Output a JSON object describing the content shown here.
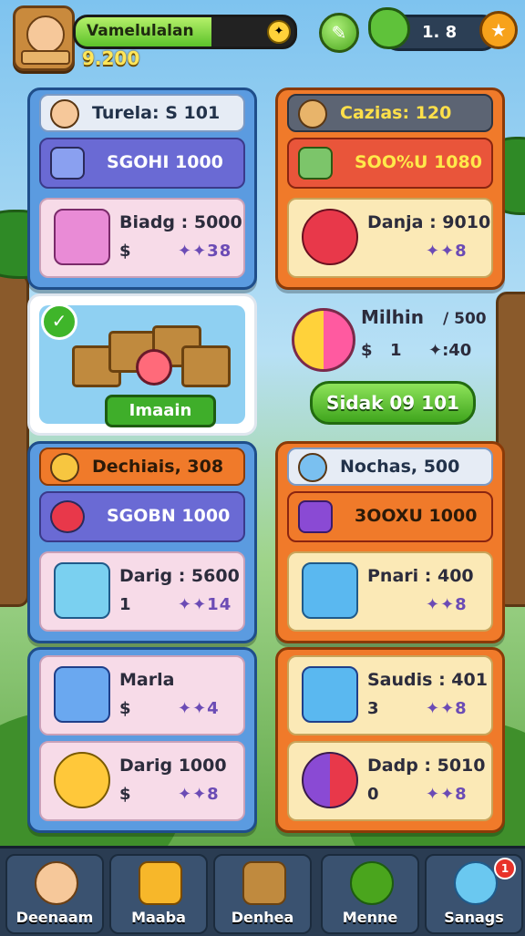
{
  "player": {
    "name": "Vamelulalan",
    "score": "9.200",
    "stat_value": "1. 8",
    "xp_fraction": 0.62
  },
  "colors": {
    "blue_panel": "#5b9be0",
    "orange_panel": "#f07a2a",
    "buy_green": "#3fa51d"
  },
  "left_top": {
    "header": "Turela: S 101",
    "row_label": "SGOHI 1000",
    "card": {
      "name": "Biadg : 5000",
      "currency": "$",
      "rate": "✦✦38"
    }
  },
  "right_top": {
    "header": "Cazias: 120",
    "row_label": "SOO%U 1080",
    "card": {
      "name": "Danja : 9010",
      "currency": "",
      "rate": "✦✦8"
    }
  },
  "hero": {
    "banner": "Imaain"
  },
  "featured": {
    "name": "Milhin",
    "rate": "/ 500",
    "currency": "$",
    "sub": "1",
    "value": "✦:40",
    "buy_label": "Sidak 09 101"
  },
  "left_mid": {
    "header": "Dechiais, 308",
    "row_label": "SGOBN 1000",
    "card": {
      "name": "Darig : 5600",
      "currency": "1",
      "rate": "✦✦14"
    }
  },
  "right_mid": {
    "header": "Nochas, 500",
    "row_label": "3OOXU 1000",
    "card": {
      "name": "Pnari : 400",
      "currency": "",
      "rate": "✦✦8"
    }
  },
  "left_bottom": {
    "card1": {
      "name": "Marla",
      "currency": "$",
      "rate": "✦✦4"
    },
    "card2": {
      "name": "Darig 1000",
      "currency": "$",
      "rate": "✦✦8"
    }
  },
  "right_bottom": {
    "card1": {
      "name": "Saudis : 401",
      "currency": "3",
      "rate": "✦✦8"
    },
    "card2": {
      "name": "Dadp : 5010",
      "currency": "0",
      "rate": "✦✦8"
    }
  },
  "nav": [
    {
      "label": "Deenaam",
      "icon": "character-icon"
    },
    {
      "label": "Maaba",
      "icon": "gift-box-icon"
    },
    {
      "label": "Denhea",
      "icon": "crate-icon"
    },
    {
      "label": "Menne",
      "icon": "bush-icon"
    },
    {
      "label": "Sanags",
      "icon": "balloon-icon",
      "badge": "1"
    }
  ]
}
